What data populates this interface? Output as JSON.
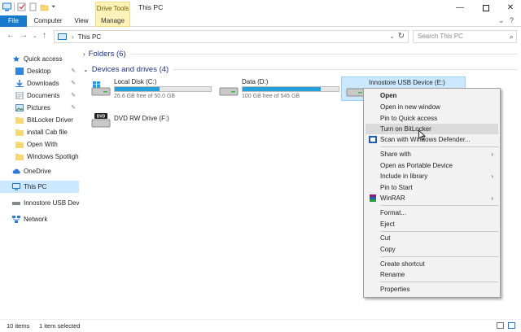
{
  "window": {
    "title": "This PC",
    "context_tab": "Drive Tools",
    "controls": [
      "minimize",
      "maximize",
      "close"
    ]
  },
  "ribbon": {
    "tabs": [
      "File",
      "Computer",
      "View",
      "Manage"
    ]
  },
  "address": {
    "path": "This PC",
    "search_placeholder": "Search This PC"
  },
  "nav": {
    "items": [
      {
        "label": "Quick access",
        "icon": "star-icon"
      },
      {
        "label": "Desktop",
        "icon": "desktop-icon",
        "pinned": true
      },
      {
        "label": "Downloads",
        "icon": "download-icon",
        "pinned": true
      },
      {
        "label": "Documents",
        "icon": "document-icon",
        "pinned": true
      },
      {
        "label": "Pictures",
        "icon": "picture-icon",
        "pinned": true
      },
      {
        "label": "BitLocker Driver",
        "icon": "folder-icon"
      },
      {
        "label": "install Cab file",
        "icon": "folder-icon"
      },
      {
        "label": "Open With",
        "icon": "folder-icon"
      },
      {
        "label": "Windows Spotlight",
        "icon": "folder-icon"
      },
      {
        "label": "OneDrive",
        "icon": "cloud-icon"
      },
      {
        "label": "This PC",
        "icon": "computer-icon",
        "selected": true
      },
      {
        "label": "Innostore USB Device",
        "icon": "usb-drive-icon"
      },
      {
        "label": "Network",
        "icon": "network-icon"
      }
    ]
  },
  "content": {
    "folders_header": "Folders (6)",
    "devices_header": "Devices and drives (4)",
    "drives": [
      {
        "name": "Local Disk (C:)",
        "free": "26.6 GB free of 50.0 GB",
        "used_fraction": 0.468,
        "icon": "windows-drive-icon"
      },
      {
        "name": "Data (D:)",
        "free": "100 GB free of 545 GB",
        "used_fraction": 0.817,
        "icon": "hard-drive-icon"
      },
      {
        "name": "Innostore USB Device (E:)",
        "free": "",
        "used_fraction": null,
        "icon": "usb-drive-icon",
        "selected": true
      },
      {
        "name": "DVD RW Drive (F:)",
        "free": "",
        "used_fraction": null,
        "icon": "dvd-drive-icon"
      }
    ]
  },
  "context_menu": {
    "items": [
      {
        "label": "Open",
        "bold": true
      },
      {
        "label": "Open in new window"
      },
      {
        "label": "Pin to Quick access"
      },
      {
        "label": "Turn on BitLocker",
        "highlighted": true
      },
      {
        "label": "Scan with Windows Defender...",
        "icon": "defender-icon"
      },
      {
        "label": "Share with",
        "submenu": true
      },
      {
        "label": "Open as Portable Device"
      },
      {
        "label": "Include in library",
        "submenu": true
      },
      {
        "label": "Pin to Start"
      },
      {
        "label": "WinRAR",
        "submenu": true,
        "icon": "winrar-icon"
      },
      {
        "label": "Format..."
      },
      {
        "label": "Eject"
      },
      {
        "label": "Cut"
      },
      {
        "label": "Copy"
      },
      {
        "label": "Create shortcut"
      },
      {
        "label": "Rename"
      },
      {
        "label": "Properties"
      }
    ]
  },
  "status": {
    "items_count": "10 items",
    "selected_count": "1 item selected"
  },
  "colors": {
    "accent": "#1979ca",
    "selection": "#cce8ff",
    "drive_bar": "#26a0da",
    "context_tab": "#fdf3b9"
  }
}
